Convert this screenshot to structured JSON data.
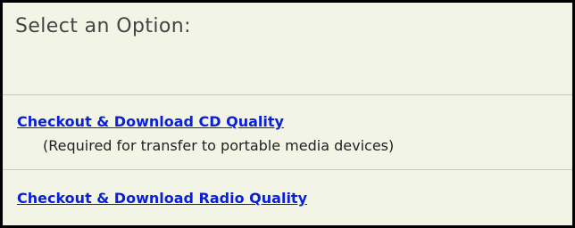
{
  "panel": {
    "title": "Select an Option:",
    "options": [
      {
        "label": "Checkout & Download CD Quality",
        "note": "(Required for transfer to portable media devices)"
      },
      {
        "label": "Checkout & Download Radio Quality"
      }
    ]
  },
  "colors": {
    "background": "#f2f5e6",
    "link": "#0a1fd8",
    "title": "#444444",
    "border": "#000000"
  }
}
